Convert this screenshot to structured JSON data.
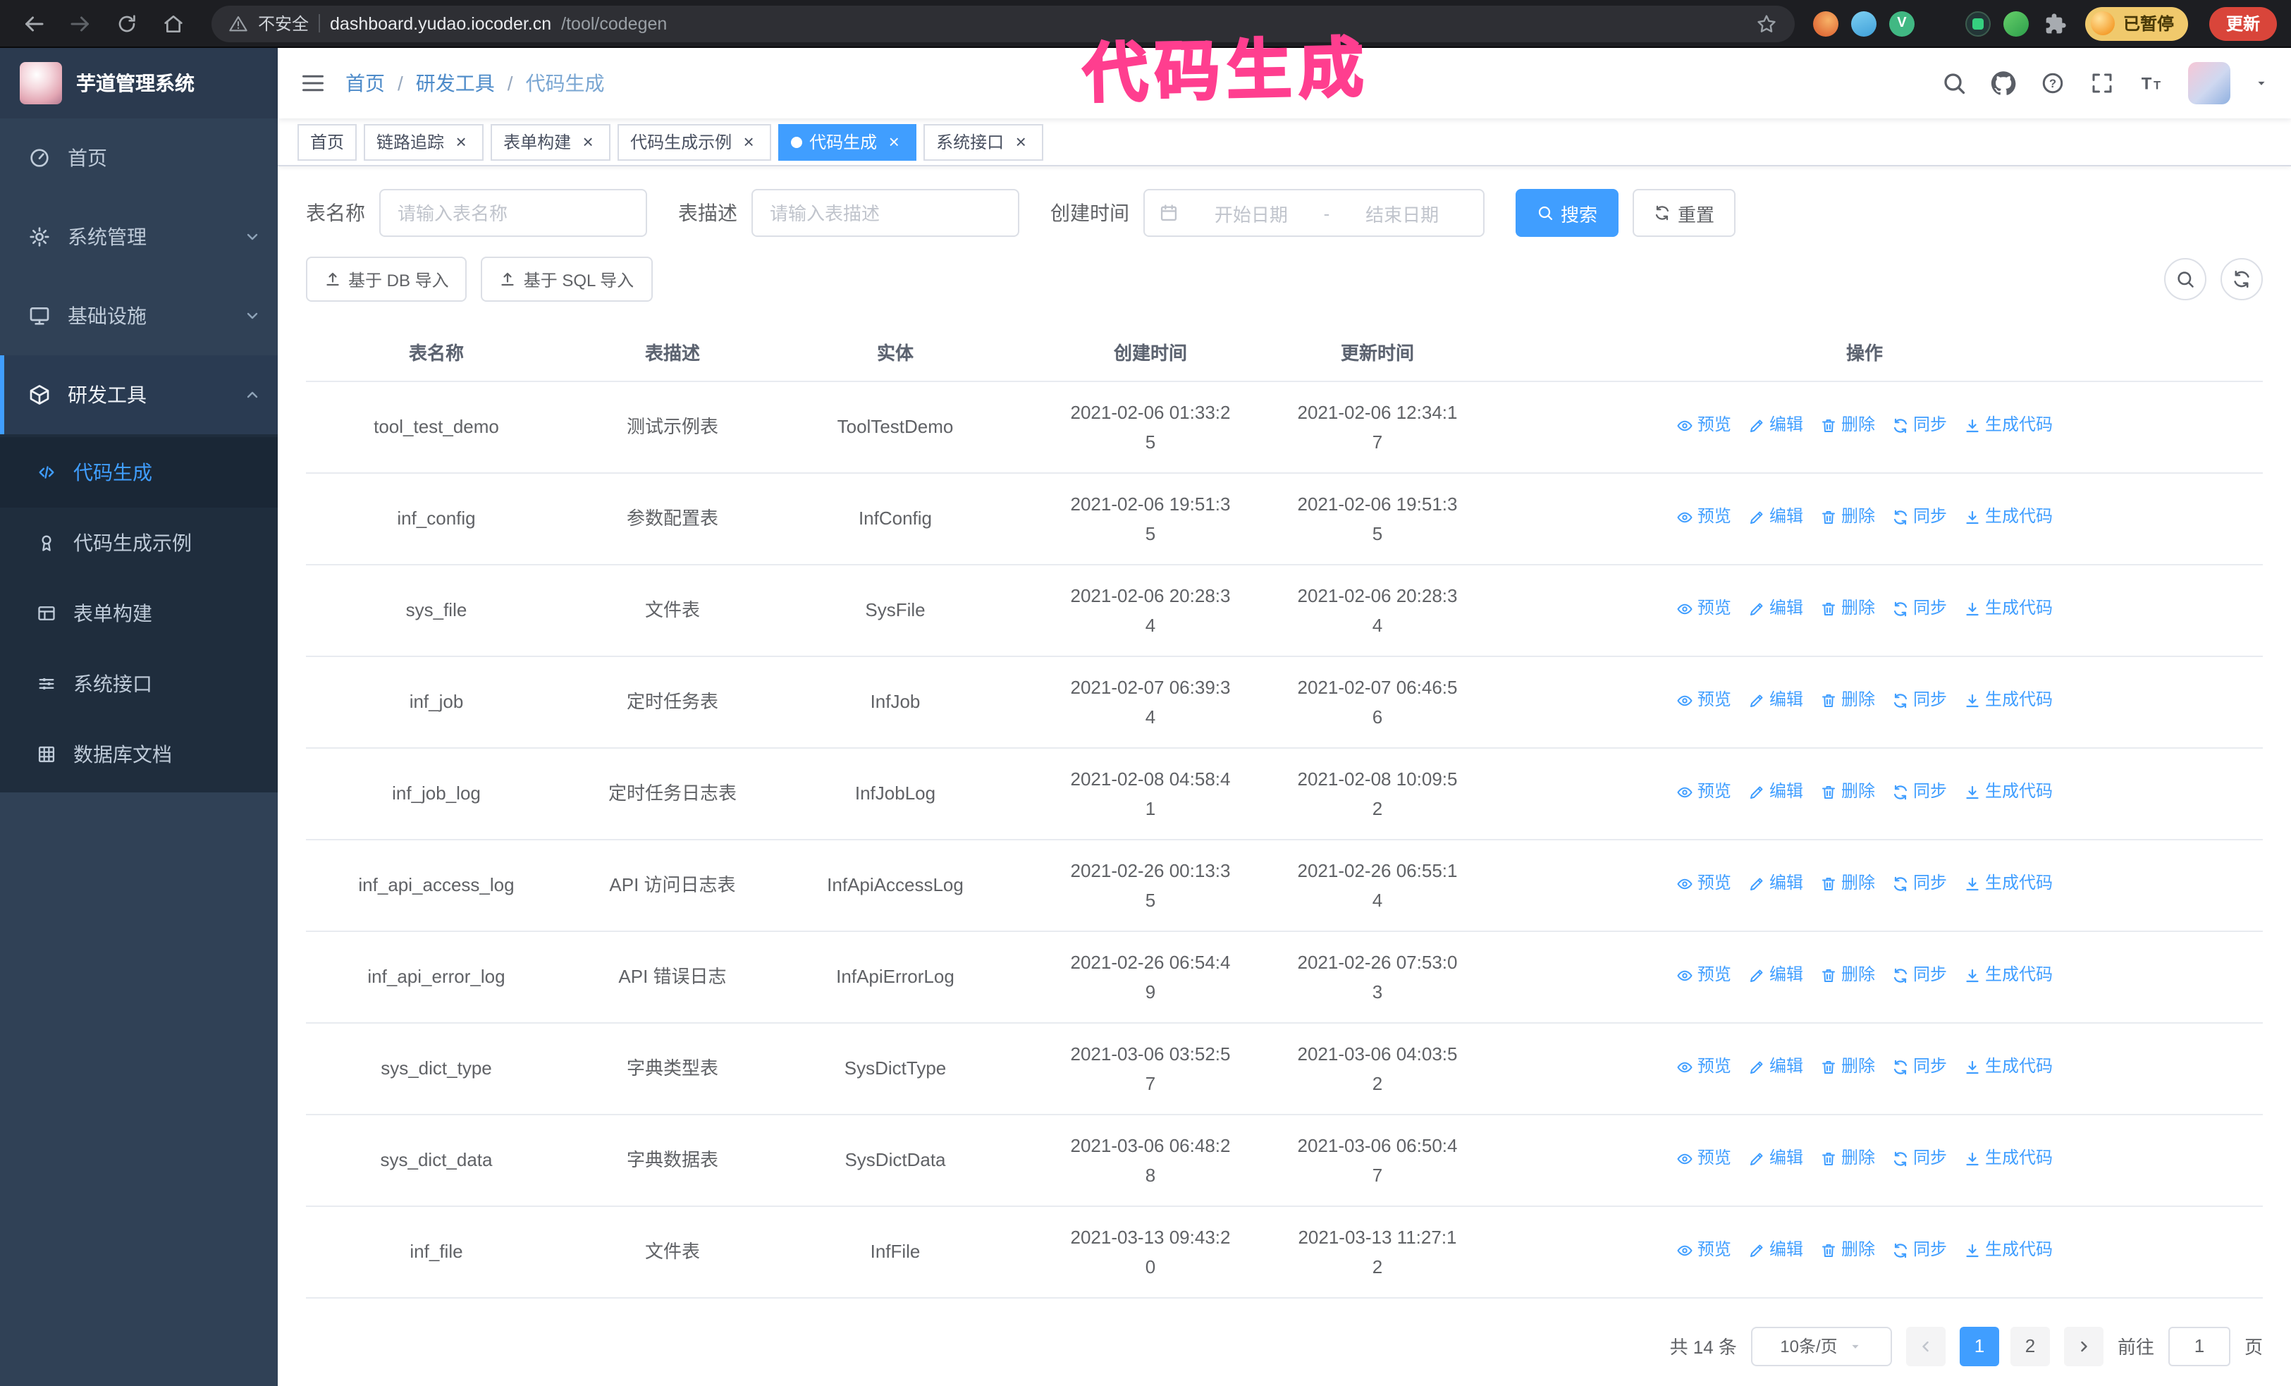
{
  "annotation": {
    "text": "代码生成",
    "color": "#ff3e8f"
  },
  "browser": {
    "security_label": "不安全",
    "url_host": "dashboard.yudao.iocoder.cn",
    "url_path": "/tool/codegen",
    "paused_chip": "已暂停",
    "update_button": "更新"
  },
  "sidebar": {
    "logo_title": "芋道管理系统",
    "items": [
      {
        "id": "home",
        "label": "首页",
        "icon": "dashboard-icon"
      },
      {
        "id": "system",
        "label": "系统管理",
        "icon": "gear-icon",
        "chevron": "down"
      },
      {
        "id": "infra",
        "label": "基础设施",
        "icon": "monitor-icon",
        "chevron": "down"
      },
      {
        "id": "devtools",
        "label": "研发工具",
        "icon": "cube-icon",
        "chevron": "up",
        "expanded": true,
        "children": [
          {
            "id": "codegen",
            "label": "代码生成",
            "icon": "code-icon",
            "active": true
          },
          {
            "id": "codegen-example",
            "label": "代码生成示例",
            "icon": "medal-icon"
          },
          {
            "id": "form-build",
            "label": "表单构建",
            "icon": "table-icon"
          },
          {
            "id": "api",
            "label": "系统接口",
            "icon": "sliders-icon"
          },
          {
            "id": "db-doc",
            "label": "数据库文档",
            "icon": "grid-icon"
          }
        ]
      }
    ]
  },
  "breadcrumb": {
    "items": [
      "首页",
      "研发工具",
      "代码生成"
    ],
    "separator": "/"
  },
  "tabs": [
    {
      "id": "home",
      "label": "首页",
      "closable": false,
      "active": false
    },
    {
      "id": "trace",
      "label": "链路追踪",
      "closable": true,
      "active": false
    },
    {
      "id": "form-build",
      "label": "表单构建",
      "closable": true,
      "active": false
    },
    {
      "id": "codegen-example",
      "label": "代码生成示例",
      "closable": true,
      "active": false
    },
    {
      "id": "codegen",
      "label": "代码生成",
      "closable": true,
      "active": true
    },
    {
      "id": "api",
      "label": "系统接口",
      "closable": true,
      "active": false
    }
  ],
  "filters": {
    "table_name_label": "表名称",
    "table_name_placeholder": "请输入表名称",
    "table_desc_label": "表描述",
    "table_desc_placeholder": "请输入表描述",
    "create_time_label": "创建时间",
    "date_start_placeholder": "开始日期",
    "date_separator": "-",
    "date_end_placeholder": "结束日期",
    "search_button": "搜索",
    "reset_button": "重置"
  },
  "toolbar": {
    "import_db": "基于 DB 导入",
    "import_sql": "基于 SQL 导入"
  },
  "table": {
    "columns": [
      "表名称",
      "表描述",
      "实体",
      "创建时间",
      "更新时间",
      "操作"
    ],
    "row_actions": [
      "预览",
      "编辑",
      "删除",
      "同步",
      "生成代码"
    ],
    "rows": [
      {
        "name": "tool_test_demo",
        "desc": "测试示例表",
        "entity": "ToolTestDemo",
        "created": "2021-02-06 01:33:25",
        "updated": "2021-02-06 12:34:17"
      },
      {
        "name": "inf_config",
        "desc": "参数配置表",
        "entity": "InfConfig",
        "created": "2021-02-06 19:51:35",
        "updated": "2021-02-06 19:51:35"
      },
      {
        "name": "sys_file",
        "desc": "文件表",
        "entity": "SysFile",
        "created": "2021-02-06 20:28:34",
        "updated": "2021-02-06 20:28:34"
      },
      {
        "name": "inf_job",
        "desc": "定时任务表",
        "entity": "InfJob",
        "created": "2021-02-07 06:39:34",
        "updated": "2021-02-07 06:46:56"
      },
      {
        "name": "inf_job_log",
        "desc": "定时任务日志表",
        "entity": "InfJobLog",
        "created": "2021-02-08 04:58:41",
        "updated": "2021-02-08 10:09:52"
      },
      {
        "name": "inf_api_access_log",
        "desc": "API 访问日志表",
        "entity": "InfApiAccessLog",
        "created": "2021-02-26 00:13:35",
        "updated": "2021-02-26 06:55:14"
      },
      {
        "name": "inf_api_error_log",
        "desc": "API 错误日志",
        "entity": "InfApiErrorLog",
        "created": "2021-02-26 06:54:49",
        "updated": "2021-02-26 07:53:03"
      },
      {
        "name": "sys_dict_type",
        "desc": "字典类型表",
        "entity": "SysDictType",
        "created": "2021-03-06 03:52:57",
        "updated": "2021-03-06 04:03:52"
      },
      {
        "name": "sys_dict_data",
        "desc": "字典数据表",
        "entity": "SysDictData",
        "created": "2021-03-06 06:48:28",
        "updated": "2021-03-06 06:50:47"
      },
      {
        "name": "inf_file",
        "desc": "文件表",
        "entity": "InfFile",
        "created": "2021-03-13 09:43:20",
        "updated": "2021-03-13 11:27:12"
      }
    ]
  },
  "pagination": {
    "total_text": "共 14 条",
    "page_size": "10条/页",
    "pages": [
      "1",
      "2"
    ],
    "active_page": "1",
    "goto_label": "前往",
    "goto_value": "1",
    "goto_suffix": "页"
  },
  "colors": {
    "primary": "#409EFF",
    "sidebar_bg": "#304156",
    "annotation": "#ff3e8f"
  }
}
